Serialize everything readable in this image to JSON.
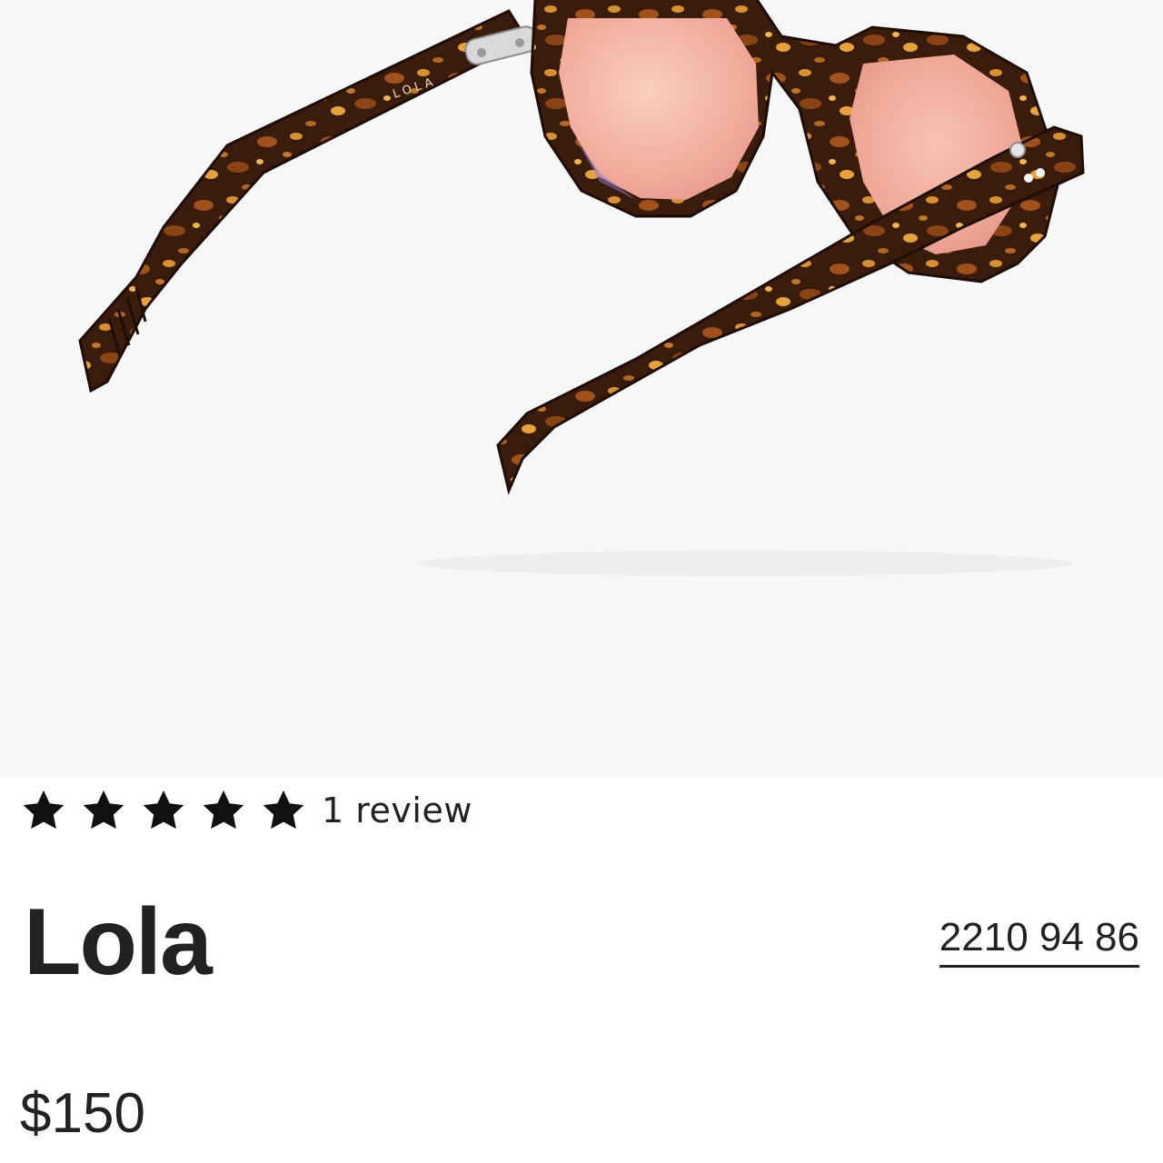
{
  "product": {
    "name": "Lola",
    "sku": "2210 94 86",
    "price": "$150",
    "rating": {
      "stars": 5,
      "max_stars": 5,
      "reviews_label": "1 review"
    },
    "image": {
      "temple_text": "LOLA",
      "frame_color": "#3a1c0d",
      "lens_color": "#f4b6a6"
    }
  },
  "icons": {
    "star": "filled-star-icon"
  }
}
